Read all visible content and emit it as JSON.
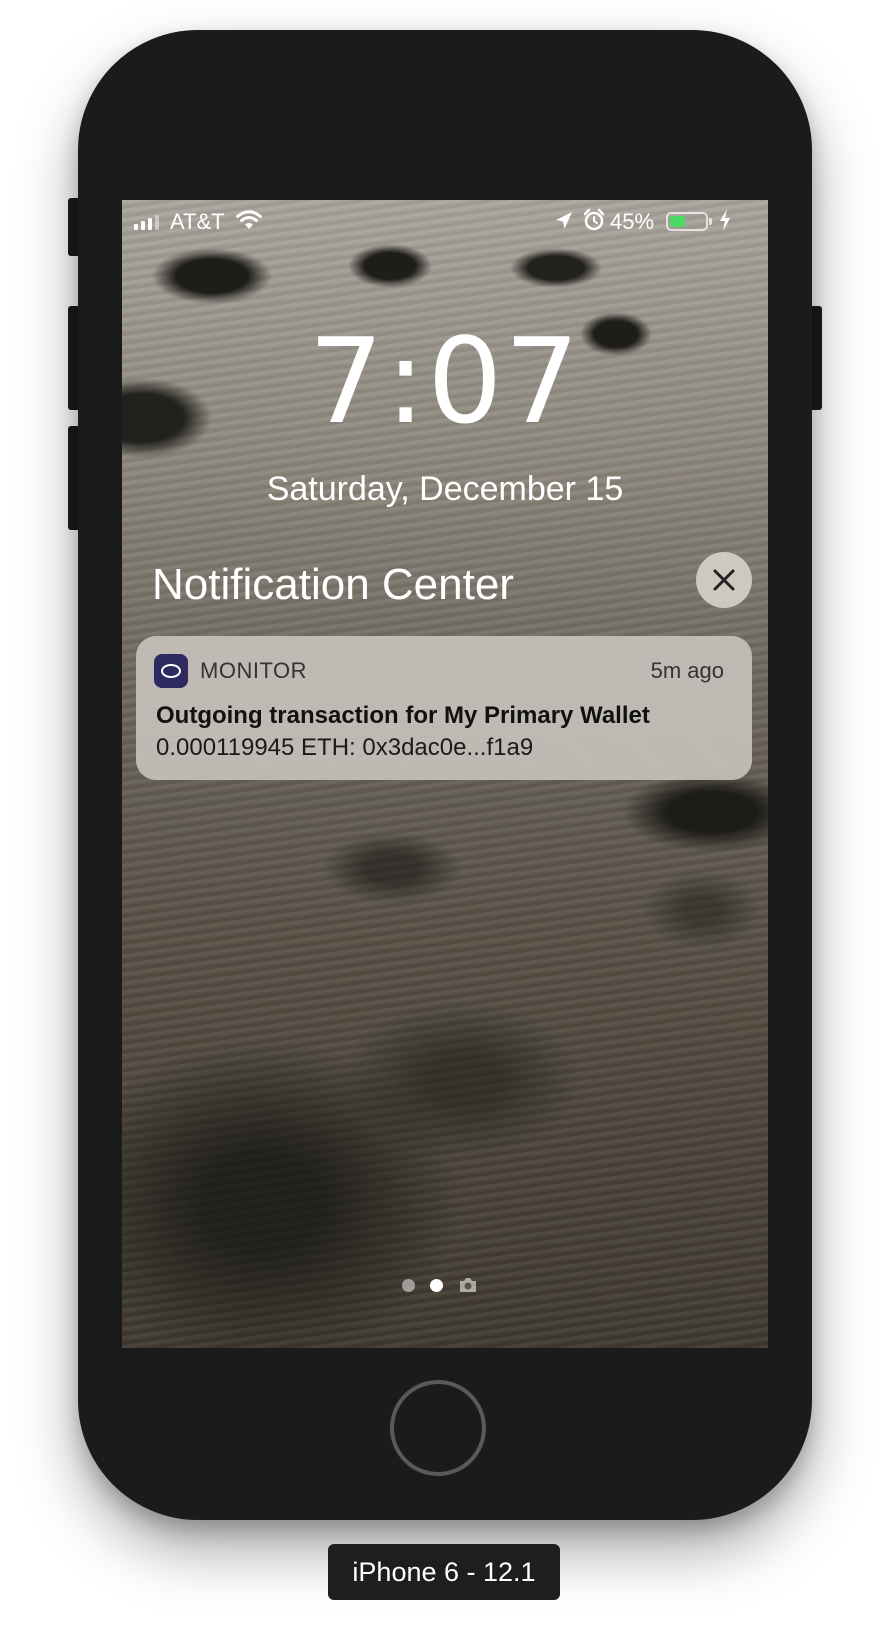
{
  "status_bar": {
    "carrier": "AT&T",
    "battery_percent_label": "45%",
    "battery_level": 0.45,
    "battery_fill_color": "#4cd964",
    "icons": [
      "signal-icon",
      "wifi-icon",
      "location-icon",
      "alarm-icon",
      "battery-icon",
      "charging-bolt-icon"
    ]
  },
  "lock_screen": {
    "time": "7:07",
    "date": "Saturday, December 15"
  },
  "notification_center": {
    "title": "Notification Center",
    "close_icon": "close-icon"
  },
  "notification": {
    "app_name": "MONITOR",
    "app_icon": "monitor-app-icon",
    "app_icon_color": "#2d2a62",
    "time": "5m ago",
    "title": "Outgoing transaction for My Primary Wallet",
    "body": "0.000119945 ETH: 0x3dac0e...f1a9"
  },
  "pager": {
    "pages": 3,
    "current_page": 2,
    "last_icon": "camera-icon"
  },
  "device": {
    "label": "iPhone 6 - 12.1"
  }
}
